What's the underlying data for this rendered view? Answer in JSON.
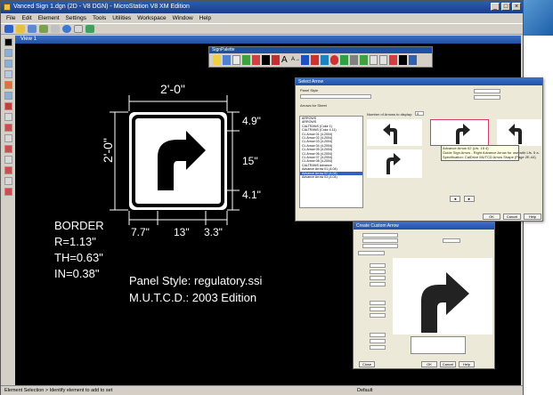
{
  "app": {
    "title": "Vanced Sign 1.dgn (2D - V8 DGN) - MicroStation V8 XM Edition",
    "menu": [
      "File",
      "Edit",
      "Element",
      "Settings",
      "Tools",
      "Utilities",
      "Workspace",
      "Window",
      "Help"
    ],
    "view_title": "View 1",
    "status_left": "Element Selection > Identify element to add to set",
    "status_right": "Default"
  },
  "drawing": {
    "width_dim": "2'-0\"",
    "height_dim": "2'-0\"",
    "right_dims": [
      "4.9\"",
      "15\"",
      "4.1\""
    ],
    "bottom_dims": [
      "7.7\"",
      "13\"",
      "3.3\""
    ],
    "border_lines": [
      "BORDER",
      "R=1.13\"",
      "TH=0.63\"",
      "IN=0.38\""
    ],
    "panel_style": "Panel Style: regulatory.ssi",
    "mutcd": "M.U.T.C.D.: 2003 Edition"
  },
  "palette": {
    "title": "SignPalette"
  },
  "select_dialog": {
    "title": "Select Arrow",
    "header_label": "Panel Style",
    "tree_title": "Arrows for Sheet",
    "count_label": "Number of Arrows to display:",
    "count_value": "4",
    "tree_items": [
      "ARROWS",
      "ARROWS",
      "CALTRANS (Color 1)",
      "CALTRANS (Color 4.11)",
      "CL Arrow 01 (4-2004)",
      "CL Arrow 02 (4-2004)",
      "CL Arrow 03 (4-2004)",
      "CL Arrow 04 (4-2004)",
      "CL Arrow 05 (4-2004)",
      "CL Arrow 06 (4-2004)",
      "CL Arrow 07 (4-2004)",
      "CL Arrow 08 (4-2004)",
      "CALTRANS Advance",
      "Advance Arrow 01 (4-04)",
      "Advance Arrow 02 (4-04)",
      "Advance Arrow 03 (4-04)"
    ],
    "tooltip": [
      "Advance Arrow 02 (Lfs. 15 4)",
      "Guide Sign Arrow - Right Advance Arrow for use with Lfs. 5 a.",
      "Specification: CalDrive MUTCD Arrow Shape (Page 2E-44)"
    ],
    "buttons": [
      "OK",
      "Cancel",
      "Help"
    ]
  },
  "create_dialog": {
    "title": "Create Custom Arrow",
    "buttons": [
      "Close",
      "OK",
      "Cancel",
      "Help"
    ]
  },
  "colors": {
    "canvas": "#000000",
    "dialog": "#ece9d8",
    "title_blue": "#1d4fa3",
    "selection": "#d0406a"
  }
}
